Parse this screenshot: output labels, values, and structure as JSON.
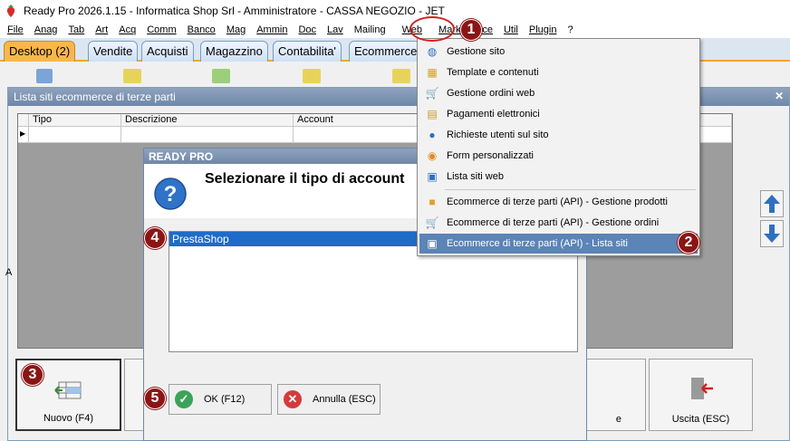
{
  "window": {
    "title": "Ready Pro 2026.1.15 - Informatica Shop Srl - Amministratore - CASSA NEGOZIO - JET"
  },
  "menubar": [
    "File",
    "Anag",
    "Tab",
    "Art",
    "Acq",
    "Comm",
    "Banco",
    "Mag",
    "Ammin",
    "Doc",
    "Lav",
    "Mailing",
    "Web",
    "Marketplace",
    "Util",
    "Plugin",
    "?"
  ],
  "tabs": [
    "Desktop (2)",
    "Vendite",
    "Acquisti",
    "Magazzino",
    "Contabilita'",
    "Ecommerce"
  ],
  "lista_window": {
    "title": "Lista siti ecommerce di terze parti",
    "columns": [
      "Tipo",
      "Descrizione",
      "Account"
    ],
    "side_letter": "A",
    "buttons": {
      "nuovo": "Nuovo (F4)",
      "uscita": "Uscita (ESC)",
      "hidden_suffix": "e"
    }
  },
  "dialog": {
    "title": "READY PRO",
    "message": "Selezionare il tipo di account",
    "list_items": [
      "PrestaShop"
    ],
    "ok": "OK (F12)",
    "cancel": "Annulla (ESC)"
  },
  "web_menu": {
    "items": [
      {
        "label": "Gestione sito",
        "icon": "globe-icon"
      },
      {
        "label": "Template e contenuti",
        "icon": "template-icon"
      },
      {
        "label": "Gestione ordini web",
        "icon": "cart-icon"
      },
      {
        "label": "Pagamenti elettronici",
        "icon": "payment-icon"
      },
      {
        "label": "Richieste utenti sul sito",
        "icon": "user-request-icon"
      },
      {
        "label": "Form personalizzati",
        "icon": "form-icon"
      },
      {
        "label": "Lista siti web",
        "icon": "site-list-icon"
      },
      {
        "label": "Ecommerce di terze parti (API) - Gestione prodotti",
        "icon": "products-icon"
      },
      {
        "label": "Ecommerce di terze parti (API) - Gestione ordini",
        "icon": "cart-icon"
      },
      {
        "label": "Ecommerce di terze parti (API) - Lista siti",
        "icon": "site-list-icon"
      }
    ]
  },
  "markers": [
    "1",
    "2",
    "3",
    "4",
    "5"
  ],
  "colors": {
    "marker": "#8b1515",
    "highlight": "#5b84b7",
    "selection": "#1e6bc8",
    "active_tab": "#f7b84a"
  }
}
